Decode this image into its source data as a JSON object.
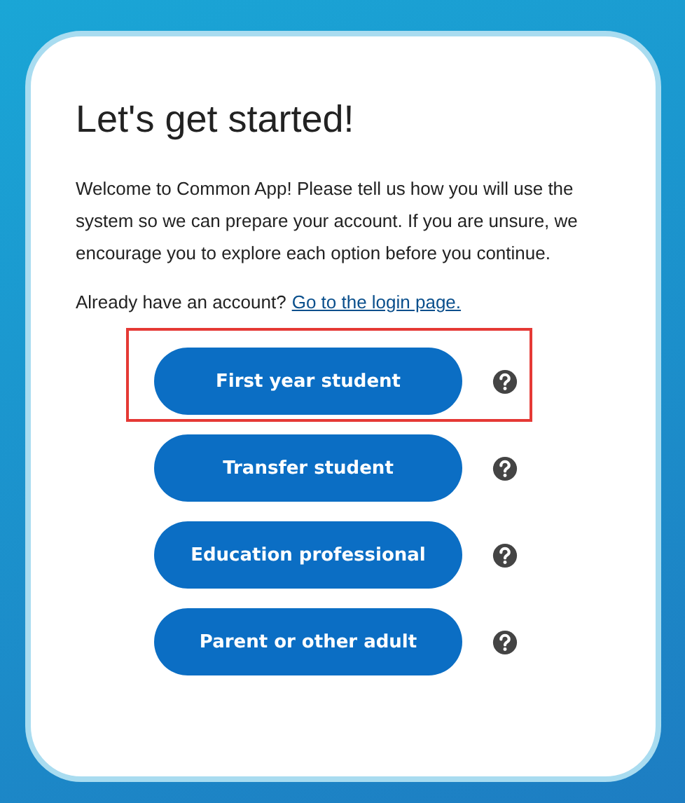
{
  "title": "Let's get started!",
  "intro": "Welcome to Common App! Please tell us how you will use the system so we can prepare your account. If you are unsure, we encourage you to explore each option before you continue.",
  "login_prompt": {
    "text": "Already have an account?",
    "link": "Go to the login page."
  },
  "options": [
    {
      "label": "First year student",
      "highlighted": true
    },
    {
      "label": "Transfer student",
      "highlighted": false
    },
    {
      "label": "Education professional",
      "highlighted": false
    },
    {
      "label": "Parent or other adult",
      "highlighted": false
    }
  ]
}
